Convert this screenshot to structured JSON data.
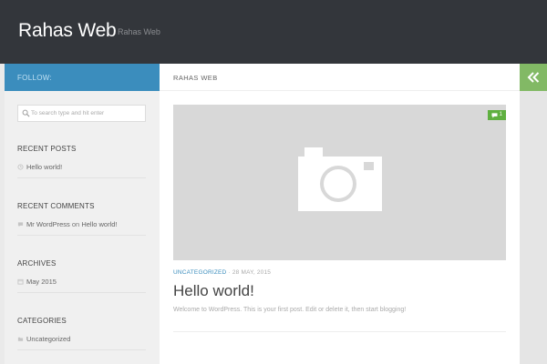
{
  "header": {
    "site_title": "Rahas Web",
    "site_description": "Rahas Web"
  },
  "sidebar": {
    "follow_label": "FOLLOW:",
    "search_placeholder": "To search type and hit enter",
    "recent_posts": {
      "title": "RECENT POSTS",
      "items": [
        {
          "label": "Hello world!"
        }
      ]
    },
    "recent_comments": {
      "title": "RECENT COMMENTS",
      "items": [
        {
          "author": "Mr WordPress",
          "connector": "on",
          "post": "Hello world!"
        }
      ]
    },
    "archives": {
      "title": "ARCHIVES",
      "items": [
        {
          "label": "May 2015"
        }
      ]
    },
    "categories": {
      "title": "CATEGORIES",
      "items": [
        {
          "label": "Uncategorized"
        }
      ]
    }
  },
  "main": {
    "section_title": "RAHAS WEB",
    "post": {
      "comment_count": "1",
      "category": "UNCATEGORIZED",
      "date": "28 MAY, 2015",
      "title": "Hello world!",
      "excerpt": "Welcome to WordPress. This is your first post. Edit or delete it, then start blogging!"
    }
  },
  "colors": {
    "header_bg": "#33363b",
    "accent_blue": "#3b8dbd",
    "accent_green": "#82b965"
  },
  "icons": {
    "collapse": "double-chevron-left-icon",
    "thumbnail_placeholder": "camera-icon"
  }
}
